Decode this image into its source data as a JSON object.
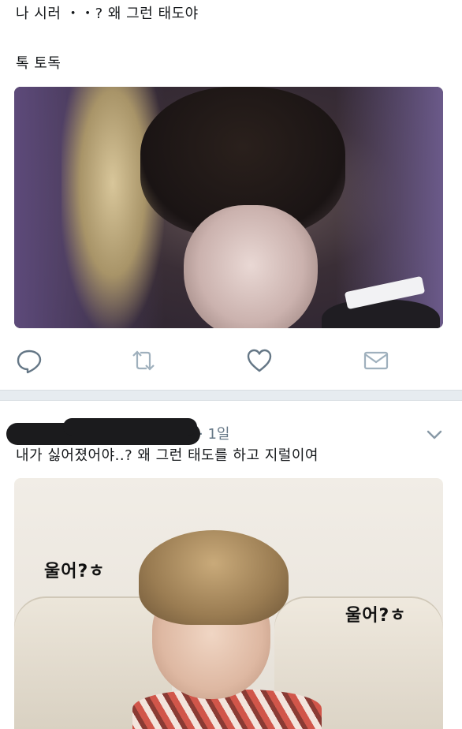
{
  "tweet1": {
    "line1": "나 시러 ・・? 왜 그런 태도야",
    "line2": "톡 토독"
  },
  "actions": {
    "reply_icon": "reply-icon",
    "retweet_icon": "retweet-icon",
    "like_icon": "heart-icon",
    "dm_icon": "envelope-icon"
  },
  "tweet2": {
    "timestamp": "· 1일",
    "text": "내가 싫어졌어야..? 왜 그런 태도를 하고 지럴이여",
    "caption_left": "울어?ㅎ",
    "caption_right": "울어?ㅎ"
  },
  "colors": {
    "icon_gray": "#657786",
    "divider": "#e6ecf0"
  }
}
